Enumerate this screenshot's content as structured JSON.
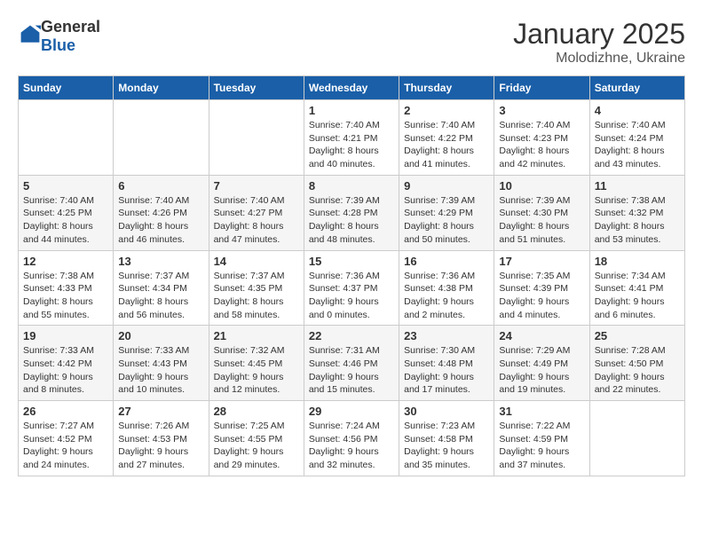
{
  "header": {
    "logo_general": "General",
    "logo_blue": "Blue",
    "title": "January 2025",
    "subtitle": "Molodizhne, Ukraine"
  },
  "days_of_week": [
    "Sunday",
    "Monday",
    "Tuesday",
    "Wednesday",
    "Thursday",
    "Friday",
    "Saturday"
  ],
  "weeks": [
    [
      {
        "day": "",
        "info": ""
      },
      {
        "day": "",
        "info": ""
      },
      {
        "day": "",
        "info": ""
      },
      {
        "day": "1",
        "info": "Sunrise: 7:40 AM\nSunset: 4:21 PM\nDaylight: 8 hours\nand 40 minutes."
      },
      {
        "day": "2",
        "info": "Sunrise: 7:40 AM\nSunset: 4:22 PM\nDaylight: 8 hours\nand 41 minutes."
      },
      {
        "day": "3",
        "info": "Sunrise: 7:40 AM\nSunset: 4:23 PM\nDaylight: 8 hours\nand 42 minutes."
      },
      {
        "day": "4",
        "info": "Sunrise: 7:40 AM\nSunset: 4:24 PM\nDaylight: 8 hours\nand 43 minutes."
      }
    ],
    [
      {
        "day": "5",
        "info": "Sunrise: 7:40 AM\nSunset: 4:25 PM\nDaylight: 8 hours\nand 44 minutes."
      },
      {
        "day": "6",
        "info": "Sunrise: 7:40 AM\nSunset: 4:26 PM\nDaylight: 8 hours\nand 46 minutes."
      },
      {
        "day": "7",
        "info": "Sunrise: 7:40 AM\nSunset: 4:27 PM\nDaylight: 8 hours\nand 47 minutes."
      },
      {
        "day": "8",
        "info": "Sunrise: 7:39 AM\nSunset: 4:28 PM\nDaylight: 8 hours\nand 48 minutes."
      },
      {
        "day": "9",
        "info": "Sunrise: 7:39 AM\nSunset: 4:29 PM\nDaylight: 8 hours\nand 50 minutes."
      },
      {
        "day": "10",
        "info": "Sunrise: 7:39 AM\nSunset: 4:30 PM\nDaylight: 8 hours\nand 51 minutes."
      },
      {
        "day": "11",
        "info": "Sunrise: 7:38 AM\nSunset: 4:32 PM\nDaylight: 8 hours\nand 53 minutes."
      }
    ],
    [
      {
        "day": "12",
        "info": "Sunrise: 7:38 AM\nSunset: 4:33 PM\nDaylight: 8 hours\nand 55 minutes."
      },
      {
        "day": "13",
        "info": "Sunrise: 7:37 AM\nSunset: 4:34 PM\nDaylight: 8 hours\nand 56 minutes."
      },
      {
        "day": "14",
        "info": "Sunrise: 7:37 AM\nSunset: 4:35 PM\nDaylight: 8 hours\nand 58 minutes."
      },
      {
        "day": "15",
        "info": "Sunrise: 7:36 AM\nSunset: 4:37 PM\nDaylight: 9 hours\nand 0 minutes."
      },
      {
        "day": "16",
        "info": "Sunrise: 7:36 AM\nSunset: 4:38 PM\nDaylight: 9 hours\nand 2 minutes."
      },
      {
        "day": "17",
        "info": "Sunrise: 7:35 AM\nSunset: 4:39 PM\nDaylight: 9 hours\nand 4 minutes."
      },
      {
        "day": "18",
        "info": "Sunrise: 7:34 AM\nSunset: 4:41 PM\nDaylight: 9 hours\nand 6 minutes."
      }
    ],
    [
      {
        "day": "19",
        "info": "Sunrise: 7:33 AM\nSunset: 4:42 PM\nDaylight: 9 hours\nand 8 minutes."
      },
      {
        "day": "20",
        "info": "Sunrise: 7:33 AM\nSunset: 4:43 PM\nDaylight: 9 hours\nand 10 minutes."
      },
      {
        "day": "21",
        "info": "Sunrise: 7:32 AM\nSunset: 4:45 PM\nDaylight: 9 hours\nand 12 minutes."
      },
      {
        "day": "22",
        "info": "Sunrise: 7:31 AM\nSunset: 4:46 PM\nDaylight: 9 hours\nand 15 minutes."
      },
      {
        "day": "23",
        "info": "Sunrise: 7:30 AM\nSunset: 4:48 PM\nDaylight: 9 hours\nand 17 minutes."
      },
      {
        "day": "24",
        "info": "Sunrise: 7:29 AM\nSunset: 4:49 PM\nDaylight: 9 hours\nand 19 minutes."
      },
      {
        "day": "25",
        "info": "Sunrise: 7:28 AM\nSunset: 4:50 PM\nDaylight: 9 hours\nand 22 minutes."
      }
    ],
    [
      {
        "day": "26",
        "info": "Sunrise: 7:27 AM\nSunset: 4:52 PM\nDaylight: 9 hours\nand 24 minutes."
      },
      {
        "day": "27",
        "info": "Sunrise: 7:26 AM\nSunset: 4:53 PM\nDaylight: 9 hours\nand 27 minutes."
      },
      {
        "day": "28",
        "info": "Sunrise: 7:25 AM\nSunset: 4:55 PM\nDaylight: 9 hours\nand 29 minutes."
      },
      {
        "day": "29",
        "info": "Sunrise: 7:24 AM\nSunset: 4:56 PM\nDaylight: 9 hours\nand 32 minutes."
      },
      {
        "day": "30",
        "info": "Sunrise: 7:23 AM\nSunset: 4:58 PM\nDaylight: 9 hours\nand 35 minutes."
      },
      {
        "day": "31",
        "info": "Sunrise: 7:22 AM\nSunset: 4:59 PM\nDaylight: 9 hours\nand 37 minutes."
      },
      {
        "day": "",
        "info": ""
      }
    ]
  ]
}
